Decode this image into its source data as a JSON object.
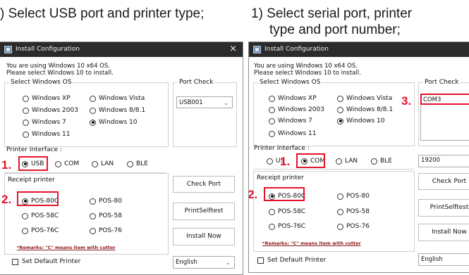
{
  "captions": {
    "left": ") Select USB port and printer type;",
    "right_line1": "1) Select serial port, printer",
    "right_line2": "type and port number;"
  },
  "left_window": {
    "title": "Install Configuration",
    "close_glyph": "×",
    "os_message_line1": "You are using Windows 10 x64 OS.",
    "os_message_line2": "Please select Windows 10 to install.",
    "windows_os_label": "Select Windows OS",
    "windows_os_options": [
      "Windows XP",
      "Windows Vista",
      "Windows 2003",
      "Windows 8/8.1",
      "Windows 7",
      "Windows 10",
      "Windows 11"
    ],
    "windows_os_selected": "Windows 10",
    "port_check_label": "Port Check",
    "port_value": "USB001",
    "printer_interface_label": "Printer Interface :",
    "interface_options": [
      "USB",
      "COM",
      "LAN",
      "BLE"
    ],
    "interface_selected": "USB",
    "receipt_printer_label": "Receipt printer",
    "printer_options": [
      "POS-80C",
      "POS-80",
      "POS-58C",
      "POS-58",
      "POS-76C",
      "POS-76"
    ],
    "printer_selected": "POS-80C",
    "remarks": "*Remarks: \"C\" means item with cutter",
    "set_default_label": "Set Default Printer",
    "buttons": {
      "check_port": "Check Port",
      "print_selftest": "PrintSelftest",
      "install_now": "Install Now"
    },
    "language": "English",
    "step_numbers": [
      "1.",
      "2."
    ]
  },
  "right_window": {
    "title": "Install Configuration",
    "os_message_line1": "You are using Windows 10 x64 OS.",
    "os_message_line2": "Please select Windows 10 to install.",
    "windows_os_label": "Select Windows OS",
    "windows_os_options": [
      "Windows XP",
      "Windows Vista",
      "Windows 2003",
      "Windows 8/8.1",
      "Windows 7",
      "Windows 10",
      "Windows 11"
    ],
    "windows_os_selected": "Windows 10",
    "port_check_label": "Port Check",
    "port_value": "COM3",
    "printer_interface_label": "Printer Interface :",
    "interface_options": [
      "US",
      "COM",
      "LAN",
      "BLE"
    ],
    "interface_selected": "COM",
    "baud_rate": "19200",
    "receipt_printer_label": "Receipt printer",
    "printer_options": [
      "POS-80C",
      "POS-80",
      "POS-58C",
      "POS-58",
      "POS-76C",
      "POS-76"
    ],
    "printer_selected": "POS-80C",
    "remarks": "*Remarks: \"C\" means item with cutter",
    "set_default_label": "Set Default Printer",
    "buttons": {
      "check_port": "Check Port",
      "print_selftest": "PrintSelftest",
      "install_now": "Install Now"
    },
    "language": "English",
    "step_numbers": [
      "1.",
      "2.",
      "3."
    ]
  },
  "colors": {
    "highlight": "#e5122a",
    "titlebar": "#2b2b2b",
    "remark": "#8b1a1a"
  },
  "icons": [
    "app-icon",
    "close-icon",
    "chevron-down-icon"
  ]
}
